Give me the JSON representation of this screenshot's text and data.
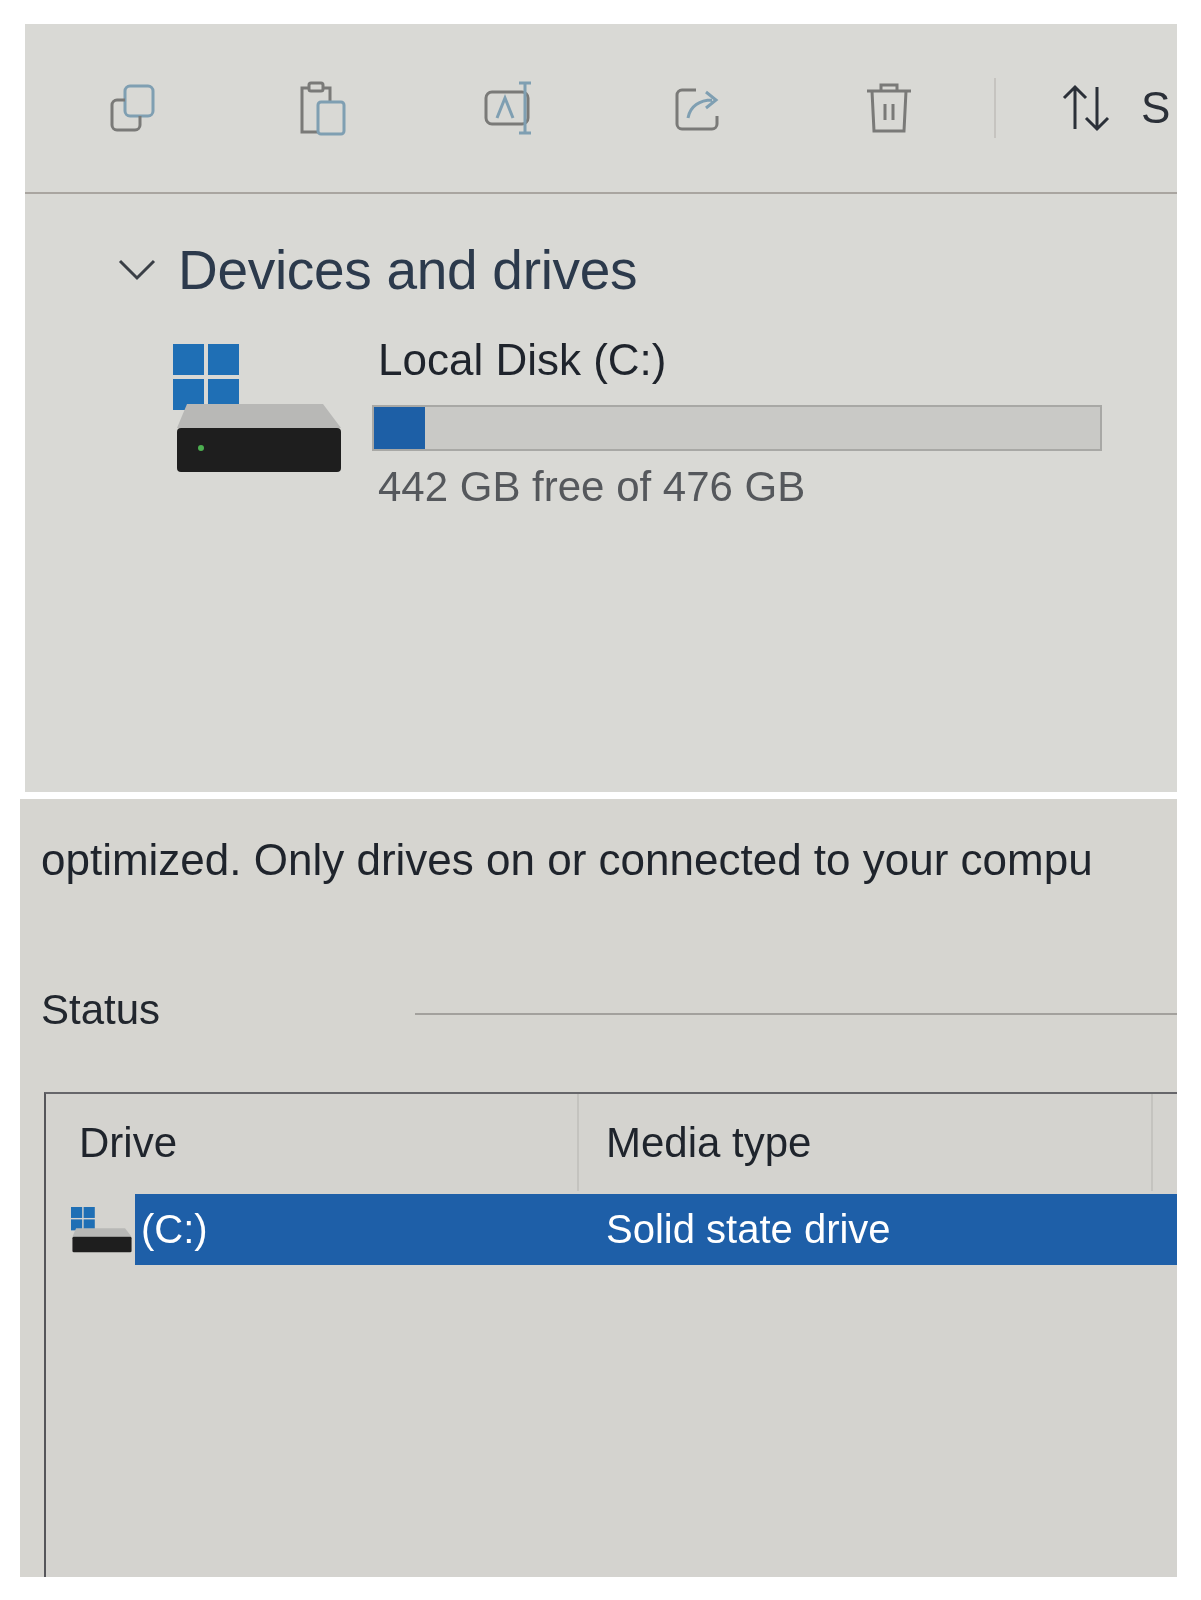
{
  "toolbar": {
    "sort_button": {
      "label": "S"
    }
  },
  "section": {
    "title": "Devices and drives",
    "expanded": true,
    "drives": [
      {
        "name": "Local Disk (C:)",
        "level": 0.07,
        "space": "442 GB free of 476 GB"
      }
    ]
  },
  "optimize_panel": {
    "description": "optimized. Only drives on or connected to your compu",
    "status_label": "Status",
    "table": {
      "columns": [
        "Drive",
        "Media type"
      ],
      "rows": [
        {
          "selected": true,
          "cells": [
            "(C:)",
            "Solid state drive"
          ]
        }
      ]
    }
  }
}
